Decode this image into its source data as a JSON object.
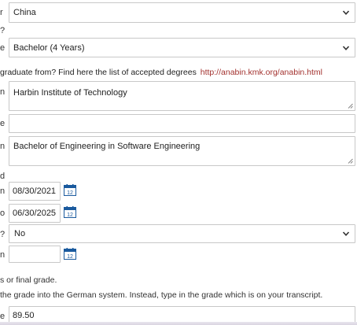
{
  "form": {
    "country": {
      "cut_label": "r",
      "value": "China"
    },
    "cut_line_2": "?",
    "degree": {
      "cut_label": "e",
      "value": "Bachelor (4 Years)"
    },
    "university_question": {
      "text": "graduate from? Find here the list of accepted degrees",
      "link": "http://anabin.kmk.org/anabin.html"
    },
    "university": {
      "cut_label": "n",
      "value": "Harbin Institute of Technology"
    },
    "empty_field": {
      "cut_label": "e",
      "value": ""
    },
    "program": {
      "cut_label": "n",
      "value": "Bachelor of Engineering in Software Engineering"
    },
    "cut_line_d": "d",
    "start_date": {
      "cut_label": "n",
      "value": "08/30/2021"
    },
    "end_date": {
      "cut_label": "o",
      "value": "06/30/2025"
    },
    "completed": {
      "cut_label": "?",
      "value": "No"
    },
    "completion_date": {
      "cut_label": "n",
      "value": ""
    },
    "grade_note_1": "s or final grade.",
    "grade_note_2": "the grade into the German system. Instead, type in the grade which is on your transcript.",
    "grade": {
      "cut_label": "e",
      "value": "89.50"
    },
    "calendar_badge": "12"
  },
  "icons": {
    "calendar": "calendar-icon",
    "chevron": "chevron-down-icon",
    "resize": "resize-grip-icon"
  },
  "colors": {
    "link": "#a3322f",
    "calendar": "#1a5a9e",
    "border": "#c8c8c8"
  }
}
